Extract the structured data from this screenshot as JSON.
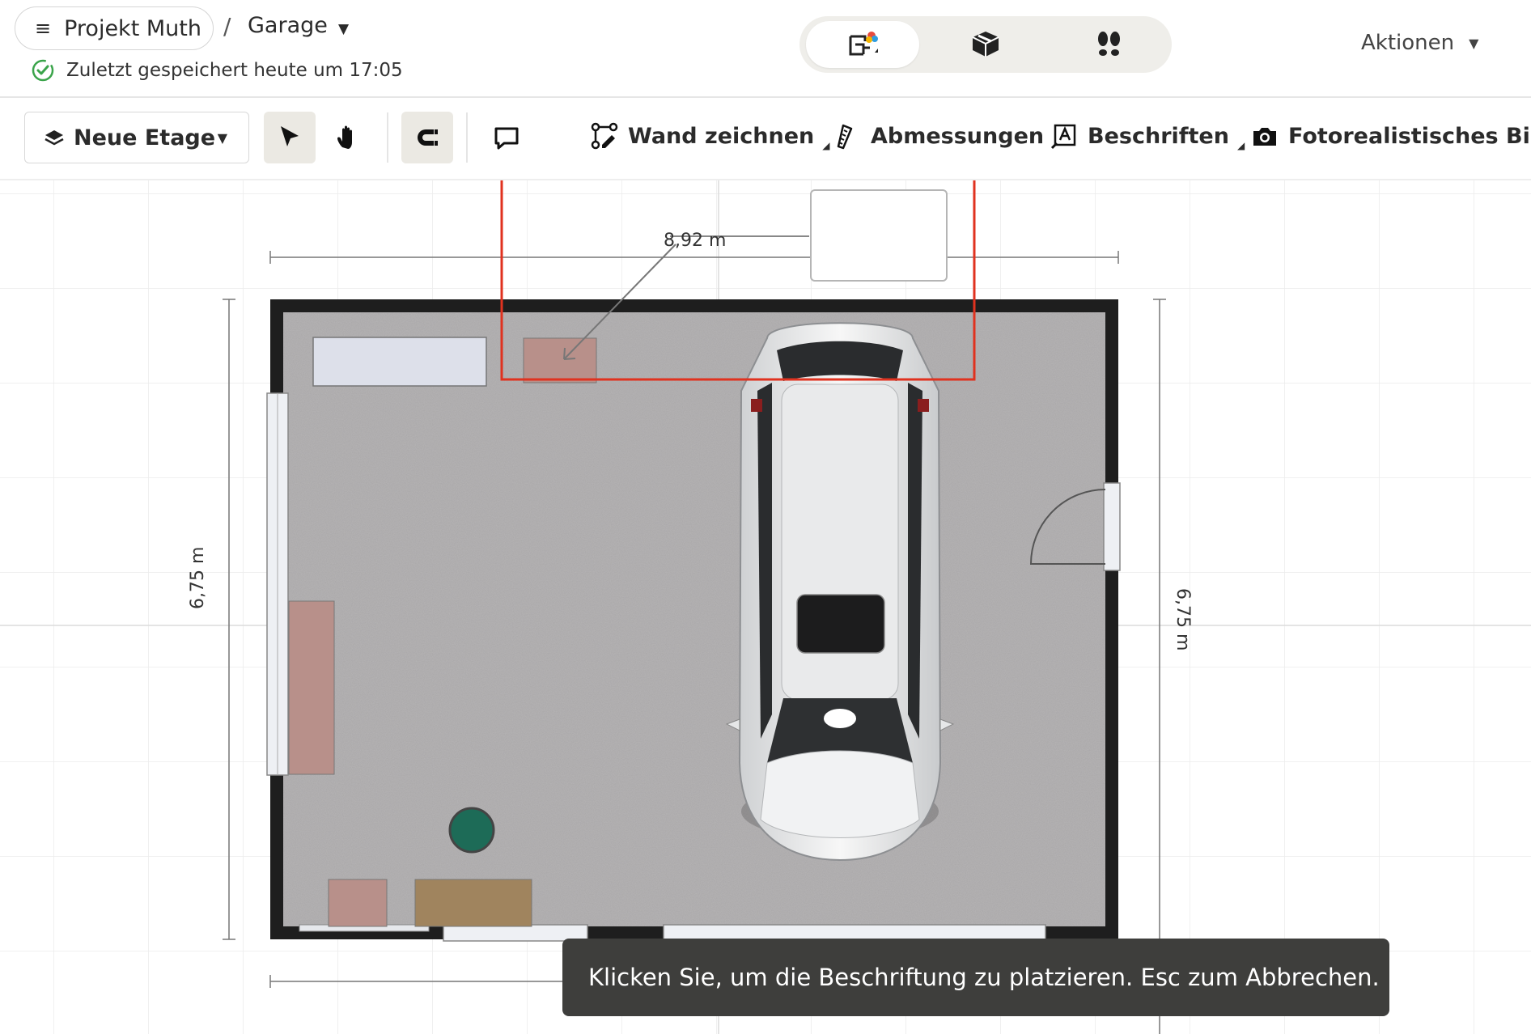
{
  "header": {
    "project_name": "Projekt Muth",
    "separator": "/",
    "room_name": "Garage",
    "saved_status": "Zuletzt gespeichert heute um 17:05",
    "actions_label": "Aktionen",
    "view_modes": [
      {
        "icon": "floorplan-2d-icon",
        "active": true
      },
      {
        "icon": "3d-box-icon",
        "active": false
      },
      {
        "icon": "footsteps-walk-icon",
        "active": false
      }
    ]
  },
  "toolbar": {
    "floor_label": "Neue Etage",
    "draw_wall_label": "Wand zeichnen",
    "dimensions_label": "Abmessungen",
    "labels_label": "Beschriften",
    "photo_label": "Fotorealistisches Bild"
  },
  "canvas": {
    "dim_width": "8,92 m",
    "dim_height_left": "6,75 m",
    "dim_height_right": "6,75 m"
  },
  "toast": {
    "message": "Klicken Sie, um die Beschriftung zu platzieren. Esc zum Abbrechen."
  },
  "colors": {
    "accent_active_bg": "#ebe9e3",
    "floor": "#a9a7a8",
    "wall": "#1f1f1f",
    "selection_red": "#e0321f",
    "toast_bg": "#3e3e3c",
    "saved_green": "#3aa44a"
  }
}
